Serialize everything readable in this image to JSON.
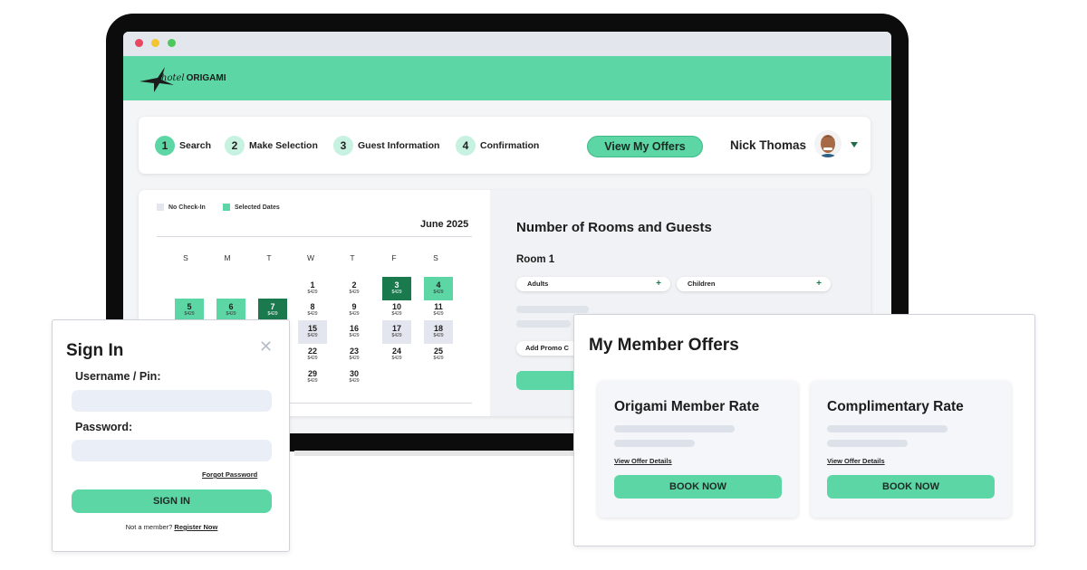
{
  "brand": {
    "logo_script": "hotel",
    "logo_name": "ORIGAMI",
    "accent": "#5dd6a6",
    "dark_accent": "#1a7a4d"
  },
  "steps": [
    {
      "num": "1",
      "label": "Search"
    },
    {
      "num": "2",
      "label": "Make Selection"
    },
    {
      "num": "3",
      "label": "Guest Information"
    },
    {
      "num": "4",
      "label": "Confirmation"
    }
  ],
  "offers_button": "View My Offers",
  "user": {
    "name": "Nick Thomas"
  },
  "calendar": {
    "legend_no_checkin": "No Check-In",
    "legend_selected": "Selected Dates",
    "month": "June 2025",
    "weekdays": [
      "S",
      "M",
      "T",
      "W",
      "T",
      "F",
      "S"
    ],
    "days": [
      {
        "n": "1",
        "p": "$429"
      },
      {
        "n": "2",
        "p": "$429"
      },
      {
        "n": "3",
        "p": "$429"
      },
      {
        "n": "4",
        "p": "$429"
      },
      {
        "n": "5",
        "p": "$429"
      },
      {
        "n": "6",
        "p": "$429"
      },
      {
        "n": "7",
        "p": "$429"
      },
      {
        "n": "8",
        "p": "$429"
      },
      {
        "n": "9",
        "p": "$429"
      },
      {
        "n": "10",
        "p": "$429"
      },
      {
        "n": "11",
        "p": "$429"
      },
      {
        "n": "15",
        "p": "$429"
      },
      {
        "n": "16",
        "p": "$429"
      },
      {
        "n": "17",
        "p": "$429"
      },
      {
        "n": "18",
        "p": "$429"
      },
      {
        "n": "22",
        "p": "$429"
      },
      {
        "n": "23",
        "p": "$429"
      },
      {
        "n": "24",
        "p": "$429"
      },
      {
        "n": "25",
        "p": "$429"
      },
      {
        "n": "29",
        "p": "$429"
      },
      {
        "n": "30",
        "p": "$429"
      }
    ]
  },
  "guests": {
    "title": "Number of Rooms and Guests",
    "room": "Room 1",
    "adults": "Adults",
    "children": "Children",
    "plus": "+",
    "promo": "Add Promo C"
  },
  "signin": {
    "title": "Sign In",
    "close": "✕",
    "username_label": "Username / Pin:",
    "password_label": "Password:",
    "forgot": "Forgot Password",
    "button": "SIGN IN",
    "not_member": "Not a member?",
    "register": "Register Now"
  },
  "member_offers": {
    "title": "My Member Offers",
    "cards": [
      {
        "name": "Origami Member Rate",
        "link": "View Offer Details",
        "button": "BOOK NOW"
      },
      {
        "name": "Complimentary Rate",
        "link": "View Offer Details",
        "button": "BOOK NOW"
      }
    ]
  }
}
